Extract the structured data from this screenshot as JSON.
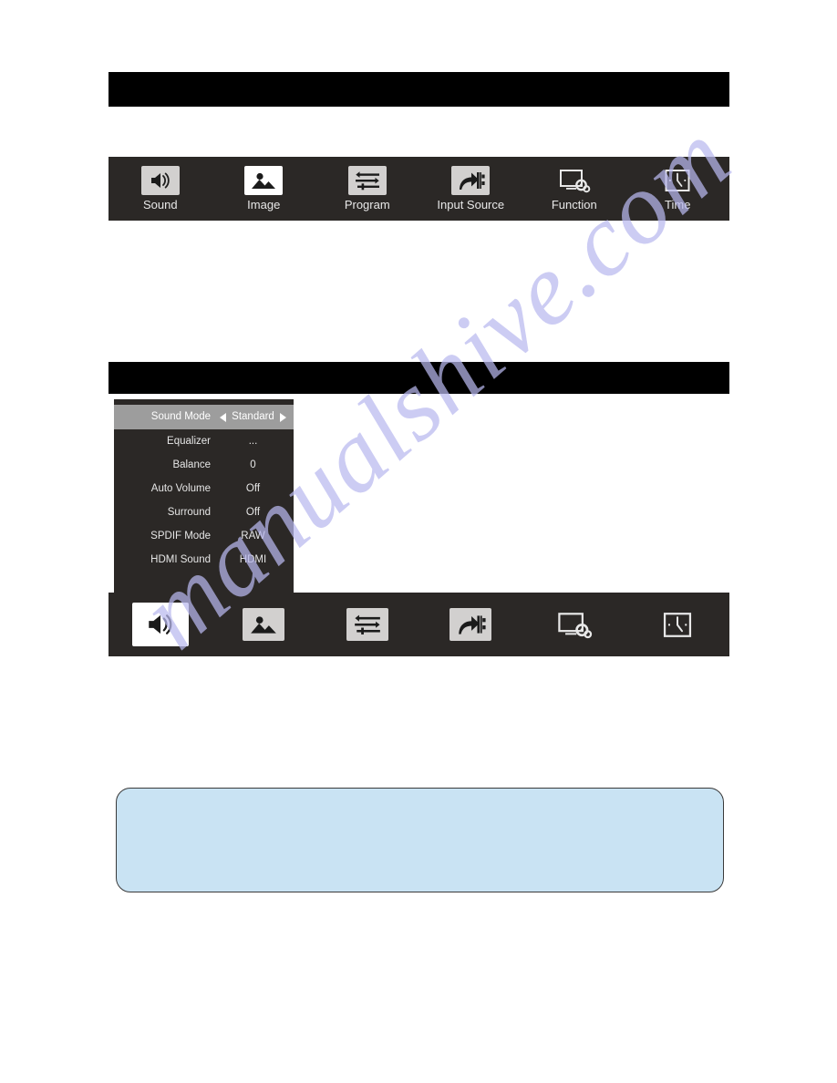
{
  "page": {
    "watermark": "manualshive.com",
    "background_color": "#ffffff"
  },
  "caption_bars": {
    "top": {
      "text": "",
      "color": "#000000"
    },
    "middle": {
      "text": "",
      "color": "#000000"
    }
  },
  "osd_menu_bar_top": {
    "background": "#2b2826",
    "items": [
      {
        "icon": "speaker-icon",
        "label": "Sound",
        "state": "grey"
      },
      {
        "icon": "picture-icon",
        "label": "Image",
        "state": "white"
      },
      {
        "icon": "sliders-icon",
        "label": "Program",
        "state": "grey"
      },
      {
        "icon": "input-source-icon",
        "label": "Input Source",
        "state": "grey"
      },
      {
        "icon": "monitor-gear-icon",
        "label": "Function",
        "state": "outline"
      },
      {
        "icon": "clock-icon",
        "label": "Time",
        "state": "outline"
      }
    ]
  },
  "osd_menu_bar_bottom": {
    "background": "#2b2826",
    "items": [
      {
        "icon": "speaker-icon",
        "label": "Sound",
        "state": "white",
        "selected": true
      },
      {
        "icon": "picture-icon",
        "label": "Image",
        "state": "grey",
        "selected": false
      },
      {
        "icon": "sliders-icon",
        "label": "Program",
        "state": "grey",
        "selected": false
      },
      {
        "icon": "input-source-icon",
        "label": "Input Source",
        "state": "grey",
        "selected": false
      },
      {
        "icon": "monitor-gear-icon",
        "label": "Function",
        "state": "outline",
        "selected": false
      },
      {
        "icon": "clock-icon",
        "label": "Time",
        "state": "outline",
        "selected": false
      }
    ]
  },
  "sound_panel": {
    "background": "#2b2826",
    "highlight_color": "#9d9d9d",
    "rows": [
      {
        "label": "Sound Mode",
        "value": "Standard",
        "highlighted": true,
        "has_arrows": true
      },
      {
        "label": "Equalizer",
        "value": "...",
        "highlighted": false,
        "has_arrows": false
      },
      {
        "label": "Balance",
        "value": "0",
        "highlighted": false,
        "has_arrows": false
      },
      {
        "label": "Auto Volume",
        "value": "Off",
        "highlighted": false,
        "has_arrows": false
      },
      {
        "label": "Surround",
        "value": "Off",
        "highlighted": false,
        "has_arrows": false
      },
      {
        "label": "SPDIF Mode",
        "value": "RAW",
        "highlighted": false,
        "has_arrows": false
      },
      {
        "label": "HDMI Sound",
        "value": "HDMI",
        "highlighted": false,
        "has_arrows": false
      }
    ]
  },
  "note_box": {
    "text": "",
    "background": "#c9e3f3",
    "border_color": "#3a3a3a"
  }
}
